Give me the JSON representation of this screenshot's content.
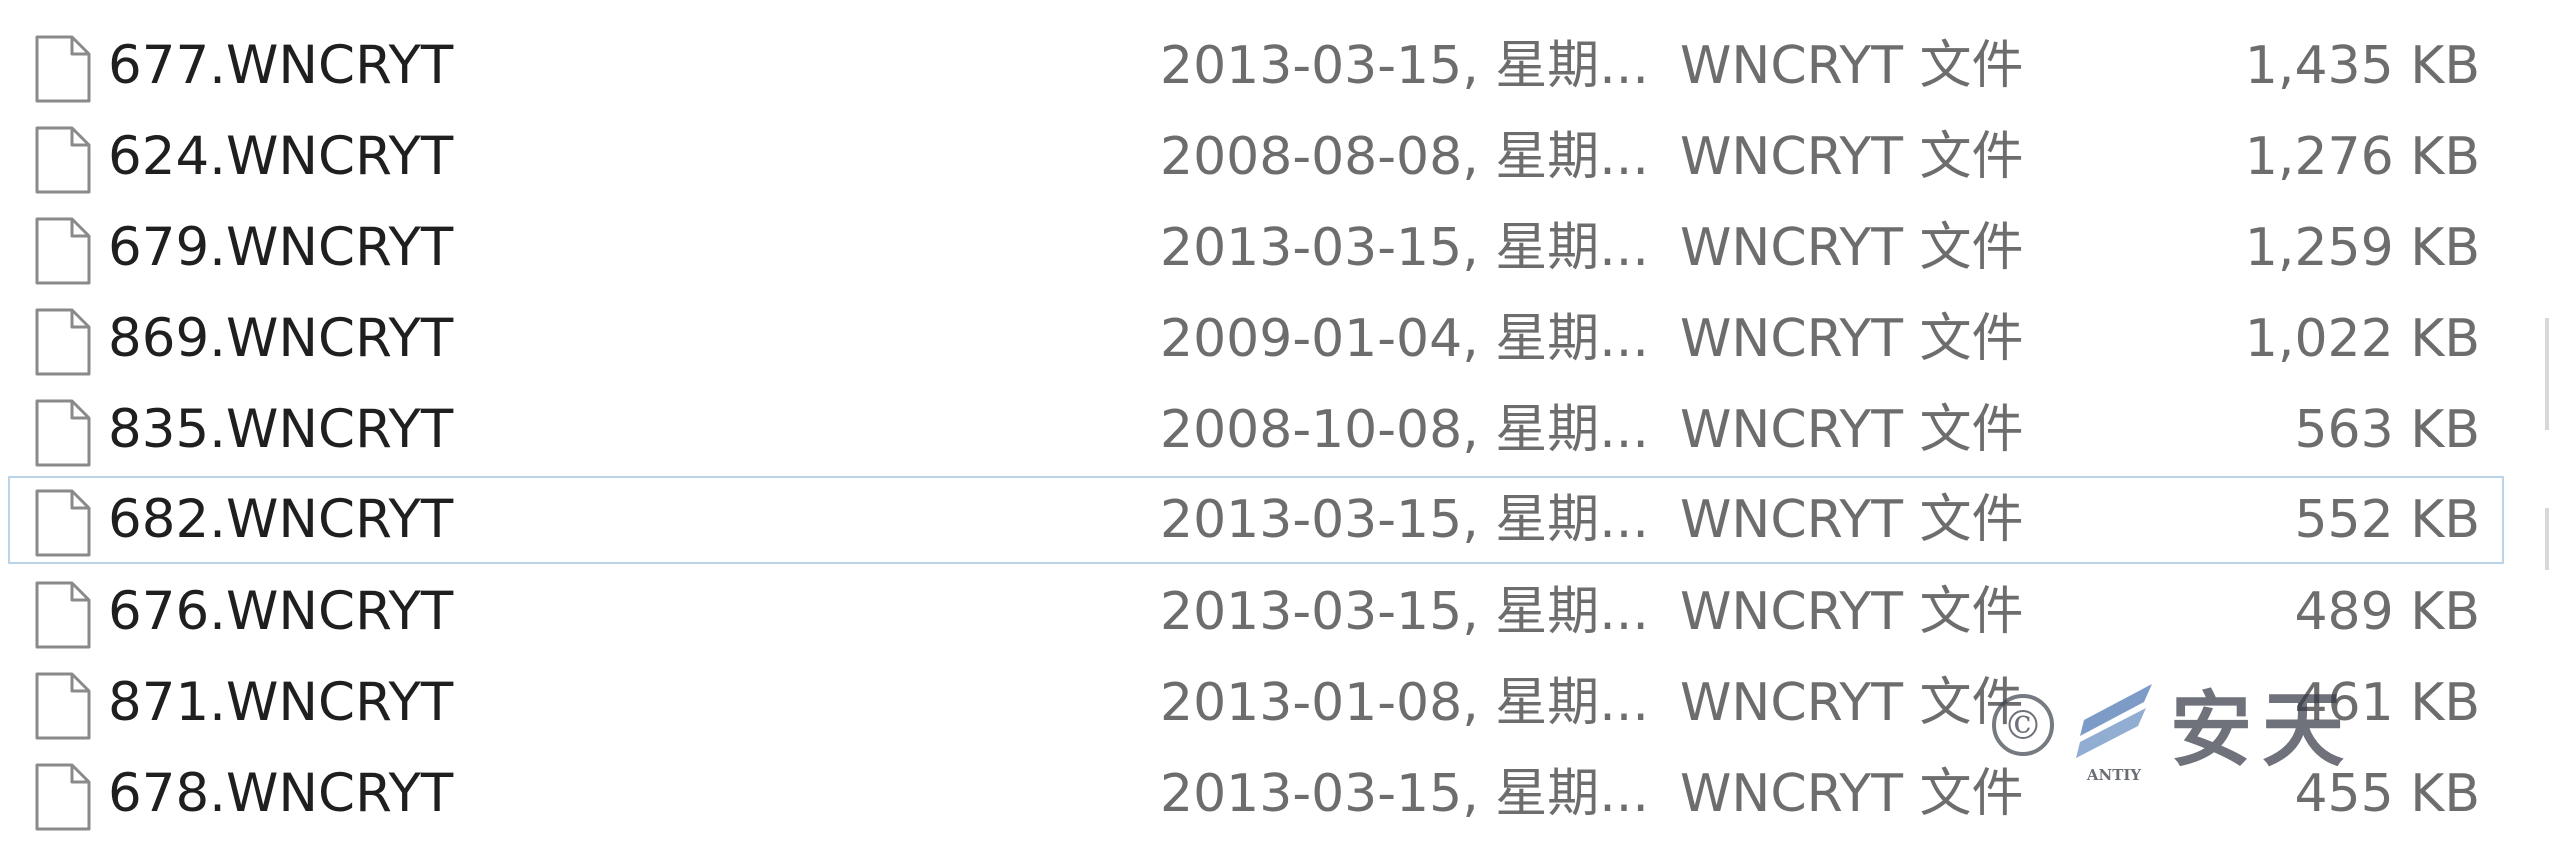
{
  "files": [
    {
      "name": "677.WNCRYT",
      "date": "2013-03-15, 星期...",
      "type": "WNCRYT 文件",
      "size": "1,435 KB",
      "focused": false
    },
    {
      "name": "624.WNCRYT",
      "date": "2008-08-08, 星期...",
      "type": "WNCRYT 文件",
      "size": "1,276 KB",
      "focused": false
    },
    {
      "name": "679.WNCRYT",
      "date": "2013-03-15, 星期...",
      "type": "WNCRYT 文件",
      "size": "1,259 KB",
      "focused": false
    },
    {
      "name": "869.WNCRYT",
      "date": "2009-01-04, 星期...",
      "type": "WNCRYT 文件",
      "size": "1,022 KB",
      "focused": false
    },
    {
      "name": "835.WNCRYT",
      "date": "2008-10-08, 星期...",
      "type": "WNCRYT 文件",
      "size": "563 KB",
      "focused": false
    },
    {
      "name": "682.WNCRYT",
      "date": "2013-03-15, 星期...",
      "type": "WNCRYT 文件",
      "size": "552 KB",
      "focused": true
    },
    {
      "name": "676.WNCRYT",
      "date": "2013-03-15, 星期...",
      "type": "WNCRYT 文件",
      "size": "489 KB",
      "focused": false
    },
    {
      "name": "871.WNCRYT",
      "date": "2013-01-08, 星期...",
      "type": "WNCRYT 文件",
      "size": "461 KB",
      "focused": false
    },
    {
      "name": "678.WNCRYT",
      "date": "2013-03-15, 星期...",
      "type": "WNCRYT 文件",
      "size": "455 KB",
      "focused": false
    }
  ],
  "file_icon": "blank-document-icon",
  "watermark": {
    "copyright_symbol": "©",
    "brand_latin": "ANTIY",
    "brand_text": "安天"
  },
  "colors": {
    "name_text": "#1f1f1f",
    "detail_text": "#6d6d6d",
    "focus_border": "#bcd4ea"
  }
}
